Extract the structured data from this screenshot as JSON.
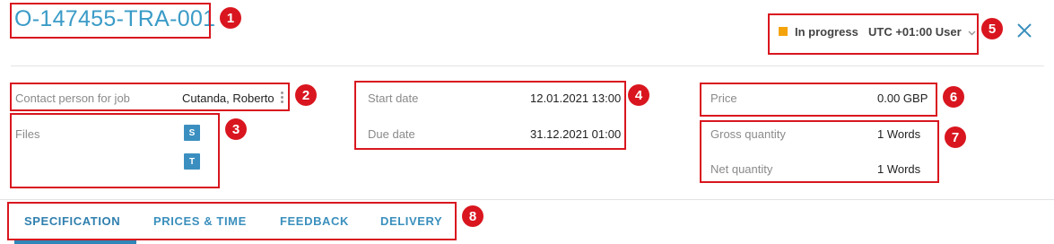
{
  "header": {
    "title": "O-147455-TRA-001",
    "status_label": "In progress",
    "status_color": "#f5a30b",
    "timezone_user": "UTC +01:00 User"
  },
  "details": {
    "contact_label": "Contact person for job",
    "contact_value": "Cutanda, Roberto",
    "files_label": "Files",
    "file_icons": [
      "S",
      "T"
    ],
    "start_label": "Start date",
    "start_value": "12.01.2021 13:00",
    "due_label": "Due date",
    "due_value": "31.12.2021 01:00",
    "price_label": "Price",
    "price_value": "0.00 GBP",
    "gross_label": "Gross quantity",
    "gross_value": "1 Words",
    "net_label": "Net quantity",
    "net_value": "1 Words"
  },
  "tabs": [
    "SPECIFICATION",
    "PRICES & TIME",
    "FEEDBACK",
    "DELIVERY"
  ],
  "annotations": [
    "1",
    "2",
    "3",
    "4",
    "5",
    "6",
    "7",
    "8"
  ],
  "colors": {
    "accent": "#3a9bc7",
    "annotation": "#d9161f"
  }
}
